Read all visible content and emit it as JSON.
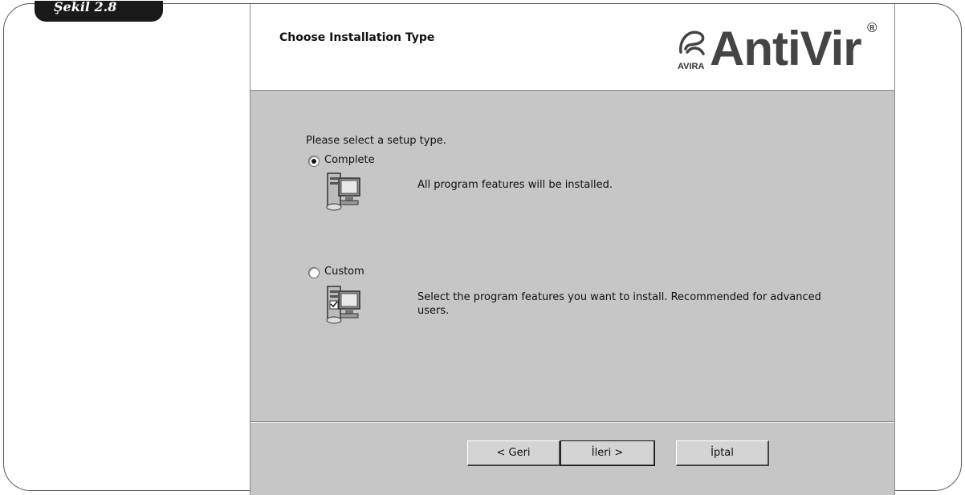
{
  "figure_label": "Şekil 2.8",
  "dialog": {
    "header_title": "Choose Installation Type",
    "logo": {
      "brand": "AntiVir",
      "sub": "AVIRA",
      "registered": "®"
    },
    "prompt": "Please select a setup type.",
    "options": [
      {
        "label": "Complete",
        "description": "All program features will be installed.",
        "selected": true,
        "icon": "computer-install-icon"
      },
      {
        "label": "Custom",
        "description": "Select the program features you want to install. Recommended for advanced users.",
        "selected": false,
        "icon": "custom-install-icon"
      }
    ],
    "buttons": {
      "back": "< Geri",
      "next": "İleri >",
      "cancel": "İptal"
    }
  }
}
